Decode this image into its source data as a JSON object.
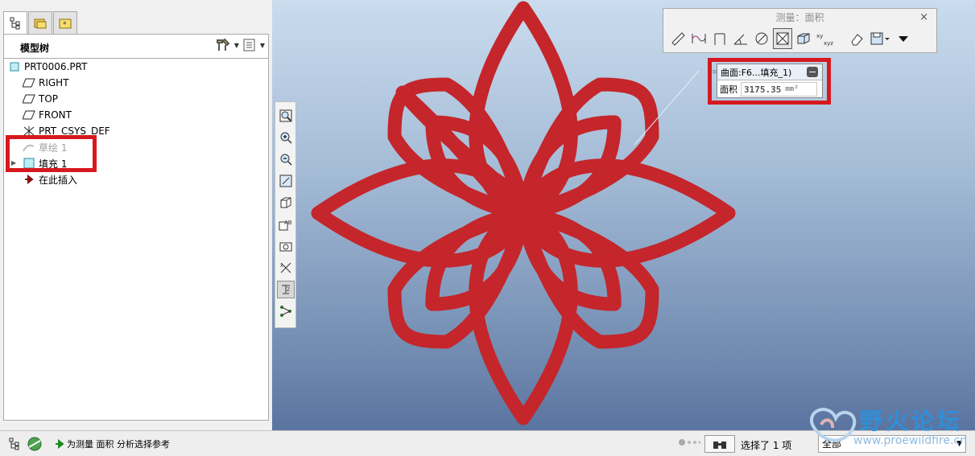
{
  "left_panel": {
    "title": "模型树",
    "tree": [
      {
        "label": "PRT0006.PRT",
        "icon": "part-icon",
        "dim": false
      },
      {
        "label": "RIGHT",
        "icon": "datum-plane-icon",
        "dim": false
      },
      {
        "label": "TOP",
        "icon": "datum-plane-icon",
        "dim": false
      },
      {
        "label": "FRONT",
        "icon": "datum-plane-icon",
        "dim": false
      },
      {
        "label": "PRT_CSYS_DEF",
        "icon": "csys-icon",
        "dim": false
      },
      {
        "label": "草绘 1",
        "icon": "sketch-icon",
        "dim": true
      },
      {
        "label": "填充 1",
        "icon": "fill-icon",
        "dim": false
      },
      {
        "label": "在此插入",
        "icon": "insert-here-arrow-icon",
        "dim": false
      }
    ]
  },
  "measure_dialog": {
    "title": "测量：面积",
    "close": "×",
    "tools": [
      "distance-icon",
      "length-icon",
      "diameter-icon",
      "angle-icon",
      "radius-icon",
      "area-icon",
      "volume-icon",
      "transform-icon",
      "eraser-icon",
      "save-icon",
      "more-icon"
    ],
    "selected_tool": "area-icon"
  },
  "result": {
    "header": "曲面:F6...填充_1)",
    "area_label": "面积",
    "area_value": "3175.35",
    "area_unit": "mm²"
  },
  "statusbar": {
    "message": "为测量 面积 分析选择参考",
    "selected": "选择了 1 项",
    "filter": "全部"
  },
  "watermark": {
    "title": "野火论坛",
    "url": "www.proewildfire.cn"
  },
  "colors": {
    "highlight": "#d7191e",
    "flower": "#c4262b"
  }
}
